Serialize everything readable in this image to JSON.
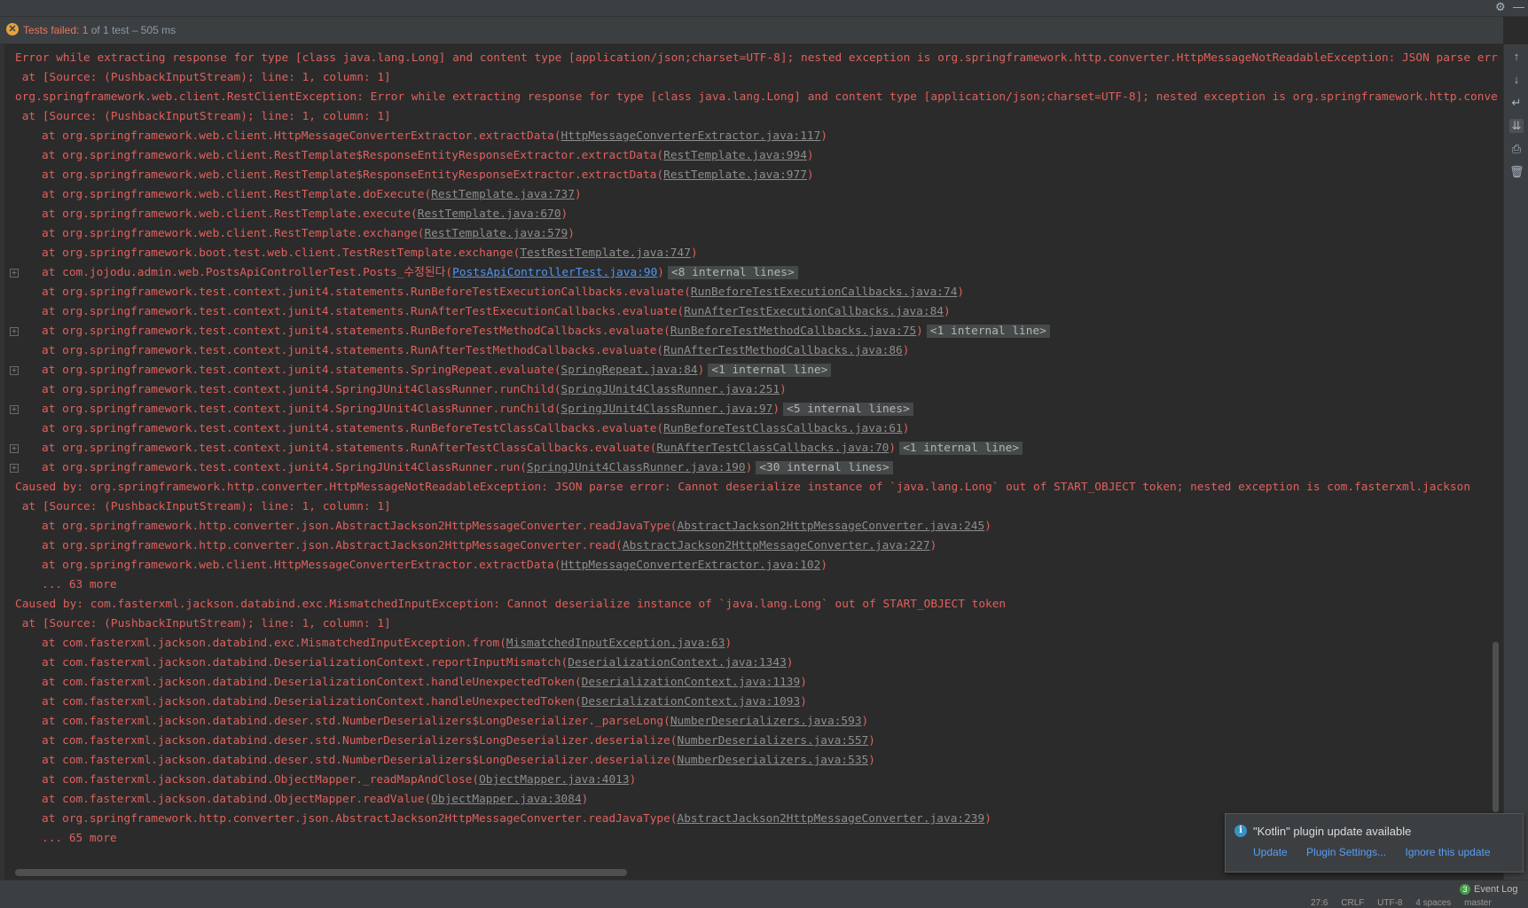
{
  "status": {
    "failed_label": "Tests failed:",
    "count": "1",
    "rest": "of 1 test – 505 ms"
  },
  "console_lines": [
    {
      "text": "Error while extracting response for type [class java.lang.Long] and content type [application/json;charset=UTF-8]; nested exception is org.springframework.http.converter.HttpMessageNotReadableException: JSON parse error: Cannot",
      "indent": 0,
      "link": "",
      "suffix": "",
      "internal": "",
      "fold": false
    },
    {
      "text": " at [Source: (PushbackInputStream); line: 1, column: 1]",
      "indent": 0,
      "link": "",
      "suffix": "",
      "internal": "",
      "fold": false
    },
    {
      "text": "org.springframework.web.client.RestClientException: Error while extracting response for type [class java.lang.Long] and content type [application/json;charset=UTF-8]; nested exception is org.springframework.http.converter",
      "indent": 0,
      "link": "",
      "suffix": "",
      "internal": "",
      "fold": false
    },
    {
      "text": " at [Source: (PushbackInputStream); line: 1, column: 1]",
      "indent": 0,
      "link": "",
      "suffix": "",
      "internal": "",
      "fold": false
    },
    {
      "text": "at org.springframework.web.client.HttpMessageConverterExtractor.extractData(",
      "indent": 1,
      "link": "HttpMessageConverterExtractor.java:117",
      "suffix": ")",
      "internal": "",
      "fold": false
    },
    {
      "text": "at org.springframework.web.client.RestTemplate$ResponseEntityResponseExtractor.extractData(",
      "indent": 1,
      "link": "RestTemplate.java:994",
      "suffix": ")",
      "internal": "",
      "fold": false
    },
    {
      "text": "at org.springframework.web.client.RestTemplate$ResponseEntityResponseExtractor.extractData(",
      "indent": 1,
      "link": "RestTemplate.java:977",
      "suffix": ")",
      "internal": "",
      "fold": false
    },
    {
      "text": "at org.springframework.web.client.RestTemplate.doExecute(",
      "indent": 1,
      "link": "RestTemplate.java:737",
      "suffix": ")",
      "internal": "",
      "fold": false
    },
    {
      "text": "at org.springframework.web.client.RestTemplate.execute(",
      "indent": 1,
      "link": "RestTemplate.java:670",
      "suffix": ")",
      "internal": "",
      "fold": false
    },
    {
      "text": "at org.springframework.web.client.RestTemplate.exchange(",
      "indent": 1,
      "link": "RestTemplate.java:579",
      "suffix": ")",
      "internal": "",
      "fold": false
    },
    {
      "text": "at org.springframework.boot.test.web.client.TestRestTemplate.exchange(",
      "indent": 1,
      "link": "TestRestTemplate.java:747",
      "suffix": ")",
      "internal": "",
      "fold": false
    },
    {
      "text": "at com.jojodu.admin.web.PostsApiControllerTest.Posts_수정된다(",
      "indent": 1,
      "link": "PostsApiControllerTest.java:90",
      "link_blue": true,
      "suffix": ")",
      "internal": "<8 internal lines>",
      "fold": true
    },
    {
      "text": "at org.springframework.test.context.junit4.statements.RunBeforeTestExecutionCallbacks.evaluate(",
      "indent": 1,
      "link": "RunBeforeTestExecutionCallbacks.java:74",
      "suffix": ")",
      "internal": "",
      "fold": false
    },
    {
      "text": "at org.springframework.test.context.junit4.statements.RunAfterTestExecutionCallbacks.evaluate(",
      "indent": 1,
      "link": "RunAfterTestExecutionCallbacks.java:84",
      "suffix": ")",
      "internal": "",
      "fold": false
    },
    {
      "text": "at org.springframework.test.context.junit4.statements.RunBeforeTestMethodCallbacks.evaluate(",
      "indent": 1,
      "link": "RunBeforeTestMethodCallbacks.java:75",
      "suffix": ")",
      "internal": "<1 internal line>",
      "fold": true
    },
    {
      "text": "at org.springframework.test.context.junit4.statements.RunAfterTestMethodCallbacks.evaluate(",
      "indent": 1,
      "link": "RunAfterTestMethodCallbacks.java:86",
      "suffix": ")",
      "internal": "",
      "fold": false
    },
    {
      "text": "at org.springframework.test.context.junit4.statements.SpringRepeat.evaluate(",
      "indent": 1,
      "link": "SpringRepeat.java:84",
      "suffix": ")",
      "internal": "<1 internal line>",
      "fold": true
    },
    {
      "text": "at org.springframework.test.context.junit4.SpringJUnit4ClassRunner.runChild(",
      "indent": 1,
      "link": "SpringJUnit4ClassRunner.java:251",
      "suffix": ")",
      "internal": "",
      "fold": false
    },
    {
      "text": "at org.springframework.test.context.junit4.SpringJUnit4ClassRunner.runChild(",
      "indent": 1,
      "link": "SpringJUnit4ClassRunner.java:97",
      "suffix": ")",
      "internal": "<5 internal lines>",
      "fold": true
    },
    {
      "text": "at org.springframework.test.context.junit4.statements.RunBeforeTestClassCallbacks.evaluate(",
      "indent": 1,
      "link": "RunBeforeTestClassCallbacks.java:61",
      "suffix": ")",
      "internal": "",
      "fold": false
    },
    {
      "text": "at org.springframework.test.context.junit4.statements.RunAfterTestClassCallbacks.evaluate(",
      "indent": 1,
      "link": "RunAfterTestClassCallbacks.java:70",
      "suffix": ")",
      "internal": "<1 internal line>",
      "fold": true
    },
    {
      "text": "at org.springframework.test.context.junit4.SpringJUnit4ClassRunner.run(",
      "indent": 1,
      "link": "SpringJUnit4ClassRunner.java:190",
      "suffix": ")",
      "internal": "<30 internal lines>",
      "fold": true
    },
    {
      "text": "Caused by: org.springframework.http.converter.HttpMessageNotReadableException: JSON parse error: Cannot deserialize instance of `java.lang.Long` out of START_OBJECT token; nested exception is com.fasterxml.jackson",
      "indent": 0,
      "link": "",
      "suffix": "",
      "internal": "",
      "fold": false
    },
    {
      "text": " at [Source: (PushbackInputStream); line: 1, column: 1]",
      "indent": 0,
      "link": "",
      "suffix": "",
      "internal": "",
      "fold": false
    },
    {
      "text": "at org.springframework.http.converter.json.AbstractJackson2HttpMessageConverter.readJavaType(",
      "indent": 1,
      "link": "AbstractJackson2HttpMessageConverter.java:245",
      "suffix": ")",
      "internal": "",
      "fold": false
    },
    {
      "text": "at org.springframework.http.converter.json.AbstractJackson2HttpMessageConverter.read(",
      "indent": 1,
      "link": "AbstractJackson2HttpMessageConverter.java:227",
      "suffix": ")",
      "internal": "",
      "fold": false
    },
    {
      "text": "at org.springframework.web.client.HttpMessageConverterExtractor.extractData(",
      "indent": 1,
      "link": "HttpMessageConverterExtractor.java:102",
      "suffix": ")",
      "internal": "",
      "fold": false
    },
    {
      "text": "... 63 more",
      "indent": 1,
      "link": "",
      "suffix": "",
      "internal": "",
      "fold": false
    },
    {
      "text": "Caused by: com.fasterxml.jackson.databind.exc.MismatchedInputException: Cannot deserialize instance of `java.lang.Long` out of START_OBJECT token",
      "indent": 0,
      "link": "",
      "suffix": "",
      "internal": "",
      "fold": false
    },
    {
      "text": " at [Source: (PushbackInputStream); line: 1, column: 1]",
      "indent": 0,
      "link": "",
      "suffix": "",
      "internal": "",
      "fold": false
    },
    {
      "text": "at com.fasterxml.jackson.databind.exc.MismatchedInputException.from(",
      "indent": 1,
      "link": "MismatchedInputException.java:63",
      "suffix": ")",
      "internal": "",
      "fold": false
    },
    {
      "text": "at com.fasterxml.jackson.databind.DeserializationContext.reportInputMismatch(",
      "indent": 1,
      "link": "DeserializationContext.java:1343",
      "suffix": ")",
      "internal": "",
      "fold": false
    },
    {
      "text": "at com.fasterxml.jackson.databind.DeserializationContext.handleUnexpectedToken(",
      "indent": 1,
      "link": "DeserializationContext.java:1139",
      "suffix": ")",
      "internal": "",
      "fold": false
    },
    {
      "text": "at com.fasterxml.jackson.databind.DeserializationContext.handleUnexpectedToken(",
      "indent": 1,
      "link": "DeserializationContext.java:1093",
      "suffix": ")",
      "internal": "",
      "fold": false
    },
    {
      "text": "at com.fasterxml.jackson.databind.deser.std.NumberDeserializers$LongDeserializer._parseLong(",
      "indent": 1,
      "link": "NumberDeserializers.java:593",
      "suffix": ")",
      "internal": "",
      "fold": false
    },
    {
      "text": "at com.fasterxml.jackson.databind.deser.std.NumberDeserializers$LongDeserializer.deserialize(",
      "indent": 1,
      "link": "NumberDeserializers.java:557",
      "suffix": ")",
      "internal": "",
      "fold": false
    },
    {
      "text": "at com.fasterxml.jackson.databind.deser.std.NumberDeserializers$LongDeserializer.deserialize(",
      "indent": 1,
      "link": "NumberDeserializers.java:535",
      "suffix": ")",
      "internal": "",
      "fold": false
    },
    {
      "text": "at com.fasterxml.jackson.databind.ObjectMapper._readMapAndClose(",
      "indent": 1,
      "link": "ObjectMapper.java:4013",
      "suffix": ")",
      "internal": "",
      "fold": false
    },
    {
      "text": "at com.fasterxml.jackson.databind.ObjectMapper.readValue(",
      "indent": 1,
      "link": "ObjectMapper.java:3084",
      "suffix": ")",
      "internal": "",
      "fold": false
    },
    {
      "text": "at org.springframework.http.converter.json.AbstractJackson2HttpMessageConverter.readJavaType(",
      "indent": 1,
      "link": "AbstractJackson2HttpMessageConverter.java:239",
      "suffix": ")",
      "internal": "",
      "fold": false
    },
    {
      "text": "... 65 more",
      "indent": 1,
      "link": "",
      "suffix": "",
      "internal": "",
      "fold": false
    }
  ],
  "notification": {
    "title": "\"Kotlin\" plugin update available",
    "actions": [
      "Update",
      "Plugin Settings...",
      "Ignore this update"
    ]
  },
  "bottom": {
    "event_log_count": "3",
    "event_log_label": "Event Log",
    "status_items": [
      "27:6",
      "CRLF",
      "UTF-8",
      "4 spaces",
      "master"
    ]
  },
  "toolbar_icons": [
    "arrow-up-icon",
    "arrow-down-icon",
    "soft-wrap-icon",
    "scroll-to-end-icon",
    "print-icon",
    "trash-icon"
  ],
  "colors": {
    "error_text": "#e0605c",
    "link_text": "#8d8d8d",
    "link_blue": "#5394ec",
    "background": "#2b2b2b"
  }
}
